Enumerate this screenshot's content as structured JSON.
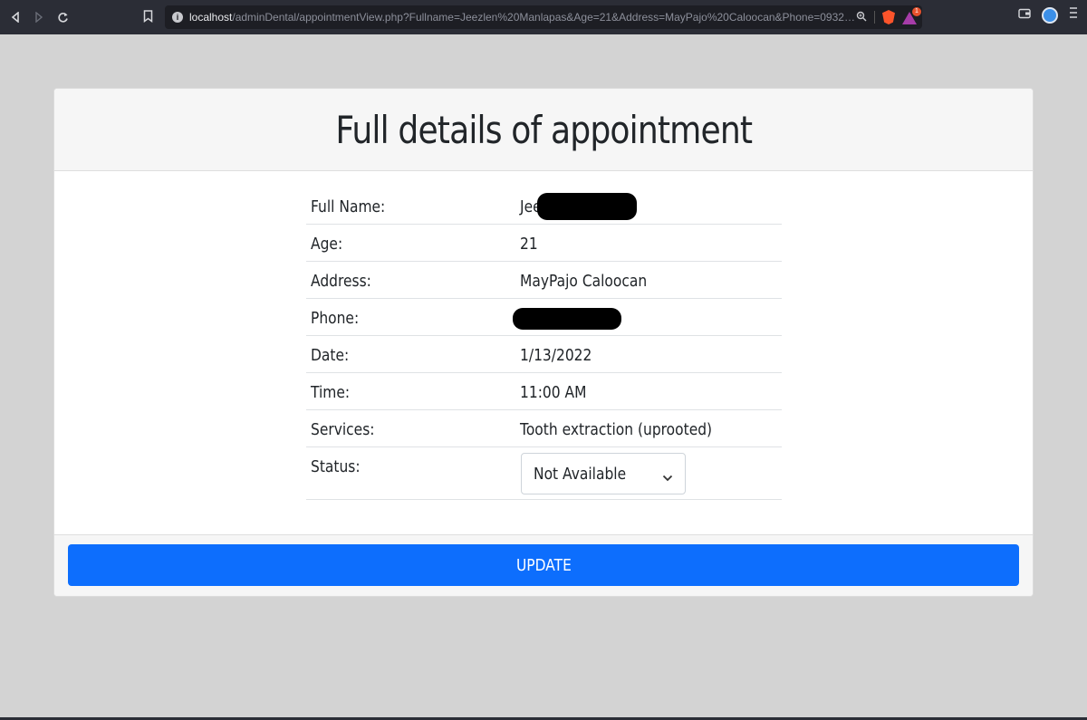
{
  "browser": {
    "url_host": "localhost",
    "url_path": "/adminDental/appointmentView.php?Fullname=Jeezlen%20Manlapas&Age=21&Address=MayPajo%20Caloocan&Phone=09323837710&D...",
    "rewards_badge": "1",
    "icons": [
      "back-icon",
      "forward-icon",
      "reload-icon",
      "bookmark-icon",
      "info-icon",
      "zoom-icon",
      "brave-shields-icon",
      "brave-rewards-icon",
      "wallet-icon",
      "profile-icon",
      "menu-icon"
    ]
  },
  "page": {
    "title": "Full details of appointment"
  },
  "details": {
    "fullname_label": "Full Name:",
    "fullname_value": "Jee",
    "age_label": "Age:",
    "age_value": "21",
    "address_label": "Address:",
    "address_value": "MayPajo Caloocan",
    "phone_label": "Phone:",
    "phone_value": "",
    "date_label": "Date:",
    "date_value": "1/13/2022",
    "time_label": "Time:",
    "time_value": "11:00 AM",
    "services_label": "Services:",
    "services_value": "Tooth extraction (uprooted)",
    "status_label": "Status:",
    "status_selected": "Not Available"
  },
  "actions": {
    "update_label": "UPDATE"
  },
  "colors": {
    "primary": "#0d6efd",
    "page_bg": "#d3d3d3",
    "chrome_bg": "#2b2d36"
  }
}
